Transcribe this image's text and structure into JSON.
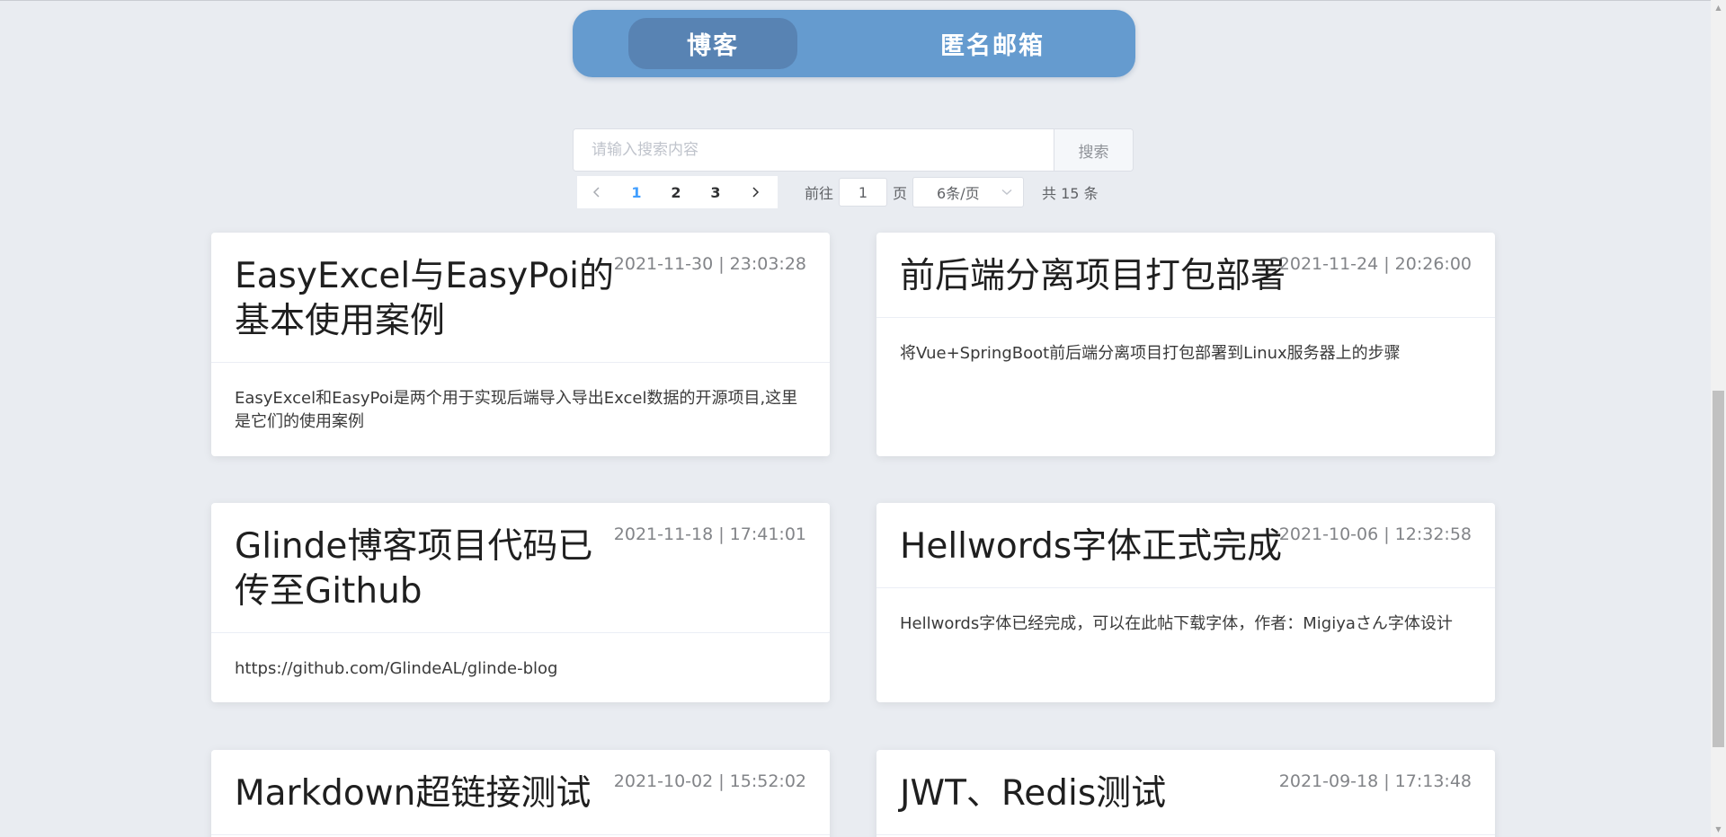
{
  "nav": {
    "tabs": [
      {
        "label": "博客",
        "active": true
      },
      {
        "label": "匿名邮箱",
        "active": false
      }
    ],
    "accent_color": "#659bcf",
    "active_tab_color": "#5883b3"
  },
  "search": {
    "placeholder": "请输入搜索内容",
    "value": "",
    "button_label": "搜索"
  },
  "pagination": {
    "prev_icon": "chevron-left-icon",
    "next_icon": "chevron-right-icon",
    "pages": [
      "1",
      "2",
      "3"
    ],
    "current_page": "1",
    "goto_label": "前往",
    "goto_value": "1",
    "page_suffix": "页",
    "page_size": "6条/页",
    "total_text": "共 15 条",
    "active_color": "#409eff"
  },
  "posts": [
    {
      "title": "EasyExcel与EasyPoi的基本使用案例",
      "date": "2021-11-30 | 23:03:28",
      "summary": "EasyExcel和EasyPoi是两个用于实现后端导入导出Excel数据的开源项目,这里是它们的使用案例"
    },
    {
      "title": "前后端分离项目打包部署",
      "date": "2021-11-24 | 20:26:00",
      "summary": "将Vue+SpringBoot前后端分离项目打包部署到Linux服务器上的步骤"
    },
    {
      "title": "Glinde博客项目代码已传至Github",
      "date": "2021-11-18 | 17:41:01",
      "summary": "https://github.com/GlindeAL/glinde-blog"
    },
    {
      "title": "Hellwords字体正式完成",
      "date": "2021-10-06 | 12:32:58",
      "summary": "Hellwords字体已经完成，可以在此帖下载字体，作者：Migiyaさん字体设计"
    },
    {
      "title": "Markdown超链接测试",
      "date": "2021-10-02 | 15:52:02",
      "summary": ""
    },
    {
      "title": "JWT、Redis测试",
      "date": "2021-09-18 | 17:13:48",
      "summary": ""
    }
  ]
}
